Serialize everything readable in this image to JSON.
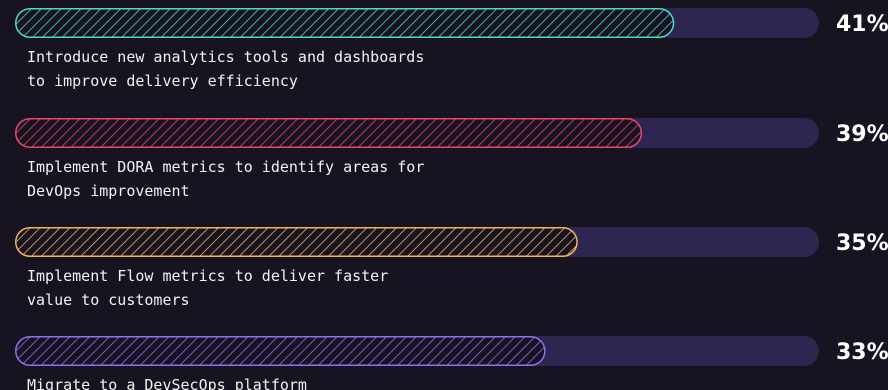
{
  "chart_data": {
    "type": "bar",
    "orientation": "horizontal",
    "xlim": [
      0,
      50
    ],
    "grid": false,
    "legend": "none",
    "items": [
      {
        "value": 41,
        "value_label": "41%",
        "label_lines": [
          "Introduce new analytics tools and dashboards",
          "to improve delivery efficiency"
        ],
        "color": "#4ed7c3"
      },
      {
        "value": 39,
        "value_label": "39%",
        "label_lines": [
          "Implement DORA metrics to identify areas for",
          "DevOps improvement"
        ],
        "color": "#e8466b"
      },
      {
        "value": 35,
        "value_label": "35%",
        "label_lines": [
          "Implement Flow metrics to deliver faster",
          "value to customers"
        ],
        "color": "#f2b35c"
      },
      {
        "value": 33,
        "value_label": "33%",
        "label_lines": [
          "Migrate to a DevSecOps platform"
        ],
        "color": "#8c72ee"
      }
    ]
  },
  "colors": {
    "background": "#171321",
    "track": "#2f2551",
    "text": "#ffffff"
  }
}
